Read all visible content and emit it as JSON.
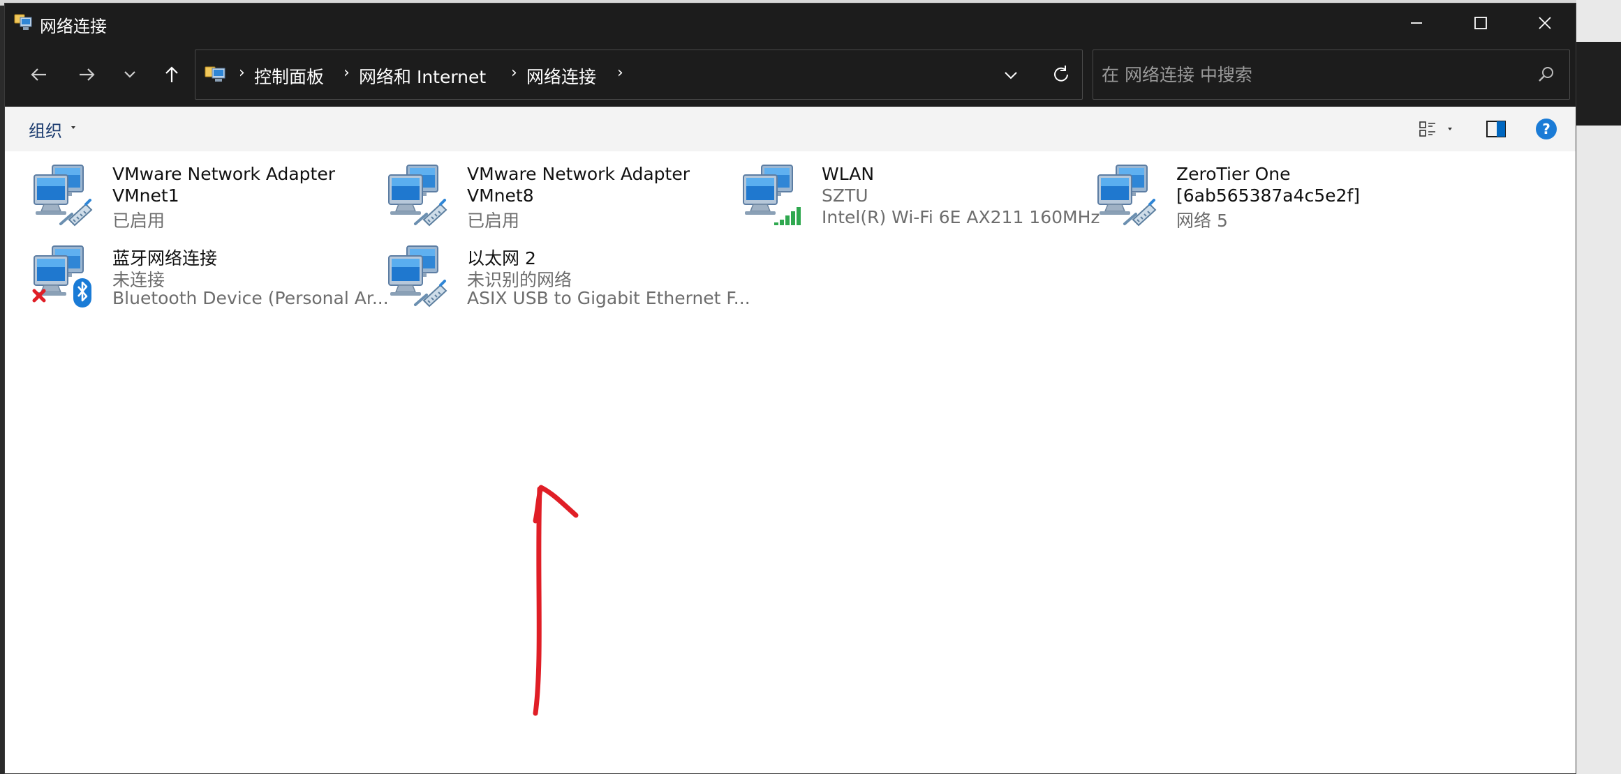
{
  "window": {
    "title": "网络连接"
  },
  "address": {
    "crumbs": [
      "控制面板",
      "网络和 Internet",
      "网络连接"
    ]
  },
  "search": {
    "placeholder": "在 网络连接 中搜索"
  },
  "commandbar": {
    "organize_label": "组织"
  },
  "icons": {
    "back": "arrow-left-icon",
    "forward": "arrow-right-icon",
    "recent": "chevron-down-icon",
    "up": "arrow-up-icon",
    "refresh": "refresh-icon",
    "search": "search-icon",
    "view": "view-options-icon",
    "preview": "preview-pane-icon",
    "help": "help-icon"
  },
  "colors": {
    "titlebar": "#1c1c1c",
    "accent": "#0067c0",
    "annotation": "#e01e26",
    "signal": "#2fa84f"
  },
  "connections": [
    {
      "name_line1": "VMware Network Adapter",
      "name_line2": "VMnet1",
      "status": "已启用",
      "device": "",
      "icon": "network-adapter-icon"
    },
    {
      "name_line1": "VMware Network Adapter",
      "name_line2": "VMnet8",
      "status": "已启用",
      "device": "",
      "icon": "network-adapter-icon"
    },
    {
      "name_line1": "WLAN",
      "name_line2": "",
      "status": "SZTU",
      "device": "Intel(R) Wi-Fi 6E AX211 160MHz",
      "icon": "wifi-adapter-icon"
    },
    {
      "name_line1": "ZeroTier One",
      "name_line2": "[6ab565387a4c5e2f]",
      "status": "网络 5",
      "device": "",
      "icon": "network-adapter-icon"
    },
    {
      "name_line1": "蓝牙网络连接",
      "name_line2": "",
      "status": "未连接",
      "device": "Bluetooth Device (Personal Ar...",
      "icon": "bluetooth-adapter-icon"
    },
    {
      "name_line1": "以太网 2",
      "name_line2": "",
      "status": "未识别的网络",
      "device": "ASIX USB to Gigabit Ethernet F...",
      "icon": "network-adapter-icon"
    }
  ]
}
